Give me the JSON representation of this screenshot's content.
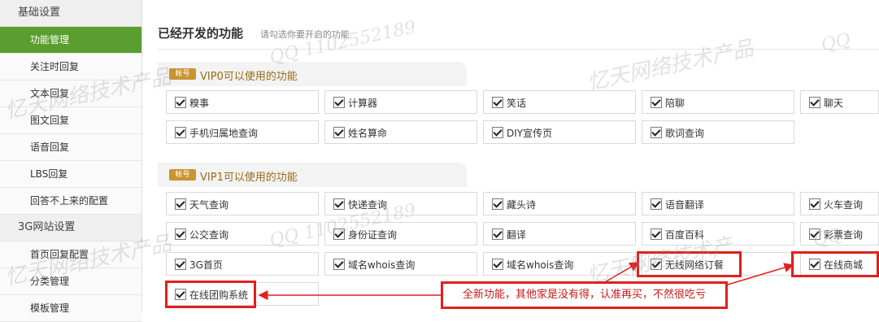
{
  "sidebar": {
    "groups": [
      {
        "label": "基础设置",
        "items": [
          "功能管理",
          "关注时回复",
          "文本回复",
          "图文回复",
          "语音回复",
          "LBS回复",
          "回答不上来的配置"
        ]
      },
      {
        "label": "3G网站设置",
        "items": [
          "首页回复配置",
          "分类管理",
          "模板管理"
        ]
      }
    ],
    "active_item": "功能管理"
  },
  "header": {
    "title": "已经开发的功能",
    "hint": "请勾选你要开启的功能"
  },
  "sections": [
    {
      "badge": "帐号",
      "title": "VIP0可以使用的功能",
      "features": [
        "糗事",
        "计算器",
        "笑话",
        "陪聊",
        "聊天",
        "手机归属地查询",
        "姓名算命",
        "DIY宣传页",
        "歌词查询"
      ]
    },
    {
      "badge": "帐号",
      "title": "VIP1可以使用的功能",
      "features": [
        "天气查询",
        "快递查询",
        "藏头诗",
        "语音翻译",
        "火车查询",
        "公交查询",
        "身份证查询",
        "翻译",
        "百度百科",
        "彩票查询",
        "3G首页",
        "域名whois查询",
        "域名whois查询",
        "无线网络订餐",
        "在线商城",
        "在线团购系统"
      ]
    }
  ],
  "annotation": {
    "text": "全新功能，其他家是没有得，认准再买，不然很吃亏",
    "color": "#e0201e"
  },
  "watermarks": [
    "忆天网络技术产品",
    "QQ 1102552189"
  ],
  "colors": {
    "active": "#5a9e2f",
    "badge": "#c79532",
    "highlight": "#e0201e"
  }
}
